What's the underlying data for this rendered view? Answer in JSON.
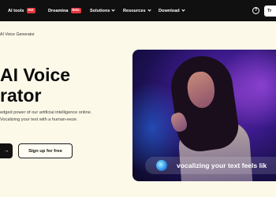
{
  "nav": {
    "items": [
      {
        "label": "AI tools",
        "badge": "Hot",
        "has_chevron": true
      },
      {
        "label": "Dreamina",
        "badge": "Beta",
        "has_chevron": false
      },
      {
        "label": "Solutions",
        "badge": "",
        "has_chevron": true
      },
      {
        "label": "Resources",
        "badge": "",
        "has_chevron": true
      },
      {
        "label": "Download",
        "badge": "",
        "has_chevron": true
      }
    ],
    "help_symbol": "?",
    "cta_label": "Tr",
    "icons": [
      "help-circle-icon",
      "chevron-down-icon"
    ],
    "badge_color": "#e4363c"
  },
  "breadcrumb": {
    "label": "AI Voice Generator"
  },
  "hero": {
    "title_line1": "AI Voice",
    "title_line2": "rator",
    "description": "edged power of our artificial intelligence online. Vocalizing your text with a human-eeze.",
    "primary_button_symbol": "→",
    "secondary_button_label": "Sign up for free"
  },
  "media": {
    "caption": "vocalizing your text feels lik"
  },
  "colors": {
    "page_background": "#fdf9e9",
    "nav_background": "#101010",
    "accent": "#111111"
  }
}
